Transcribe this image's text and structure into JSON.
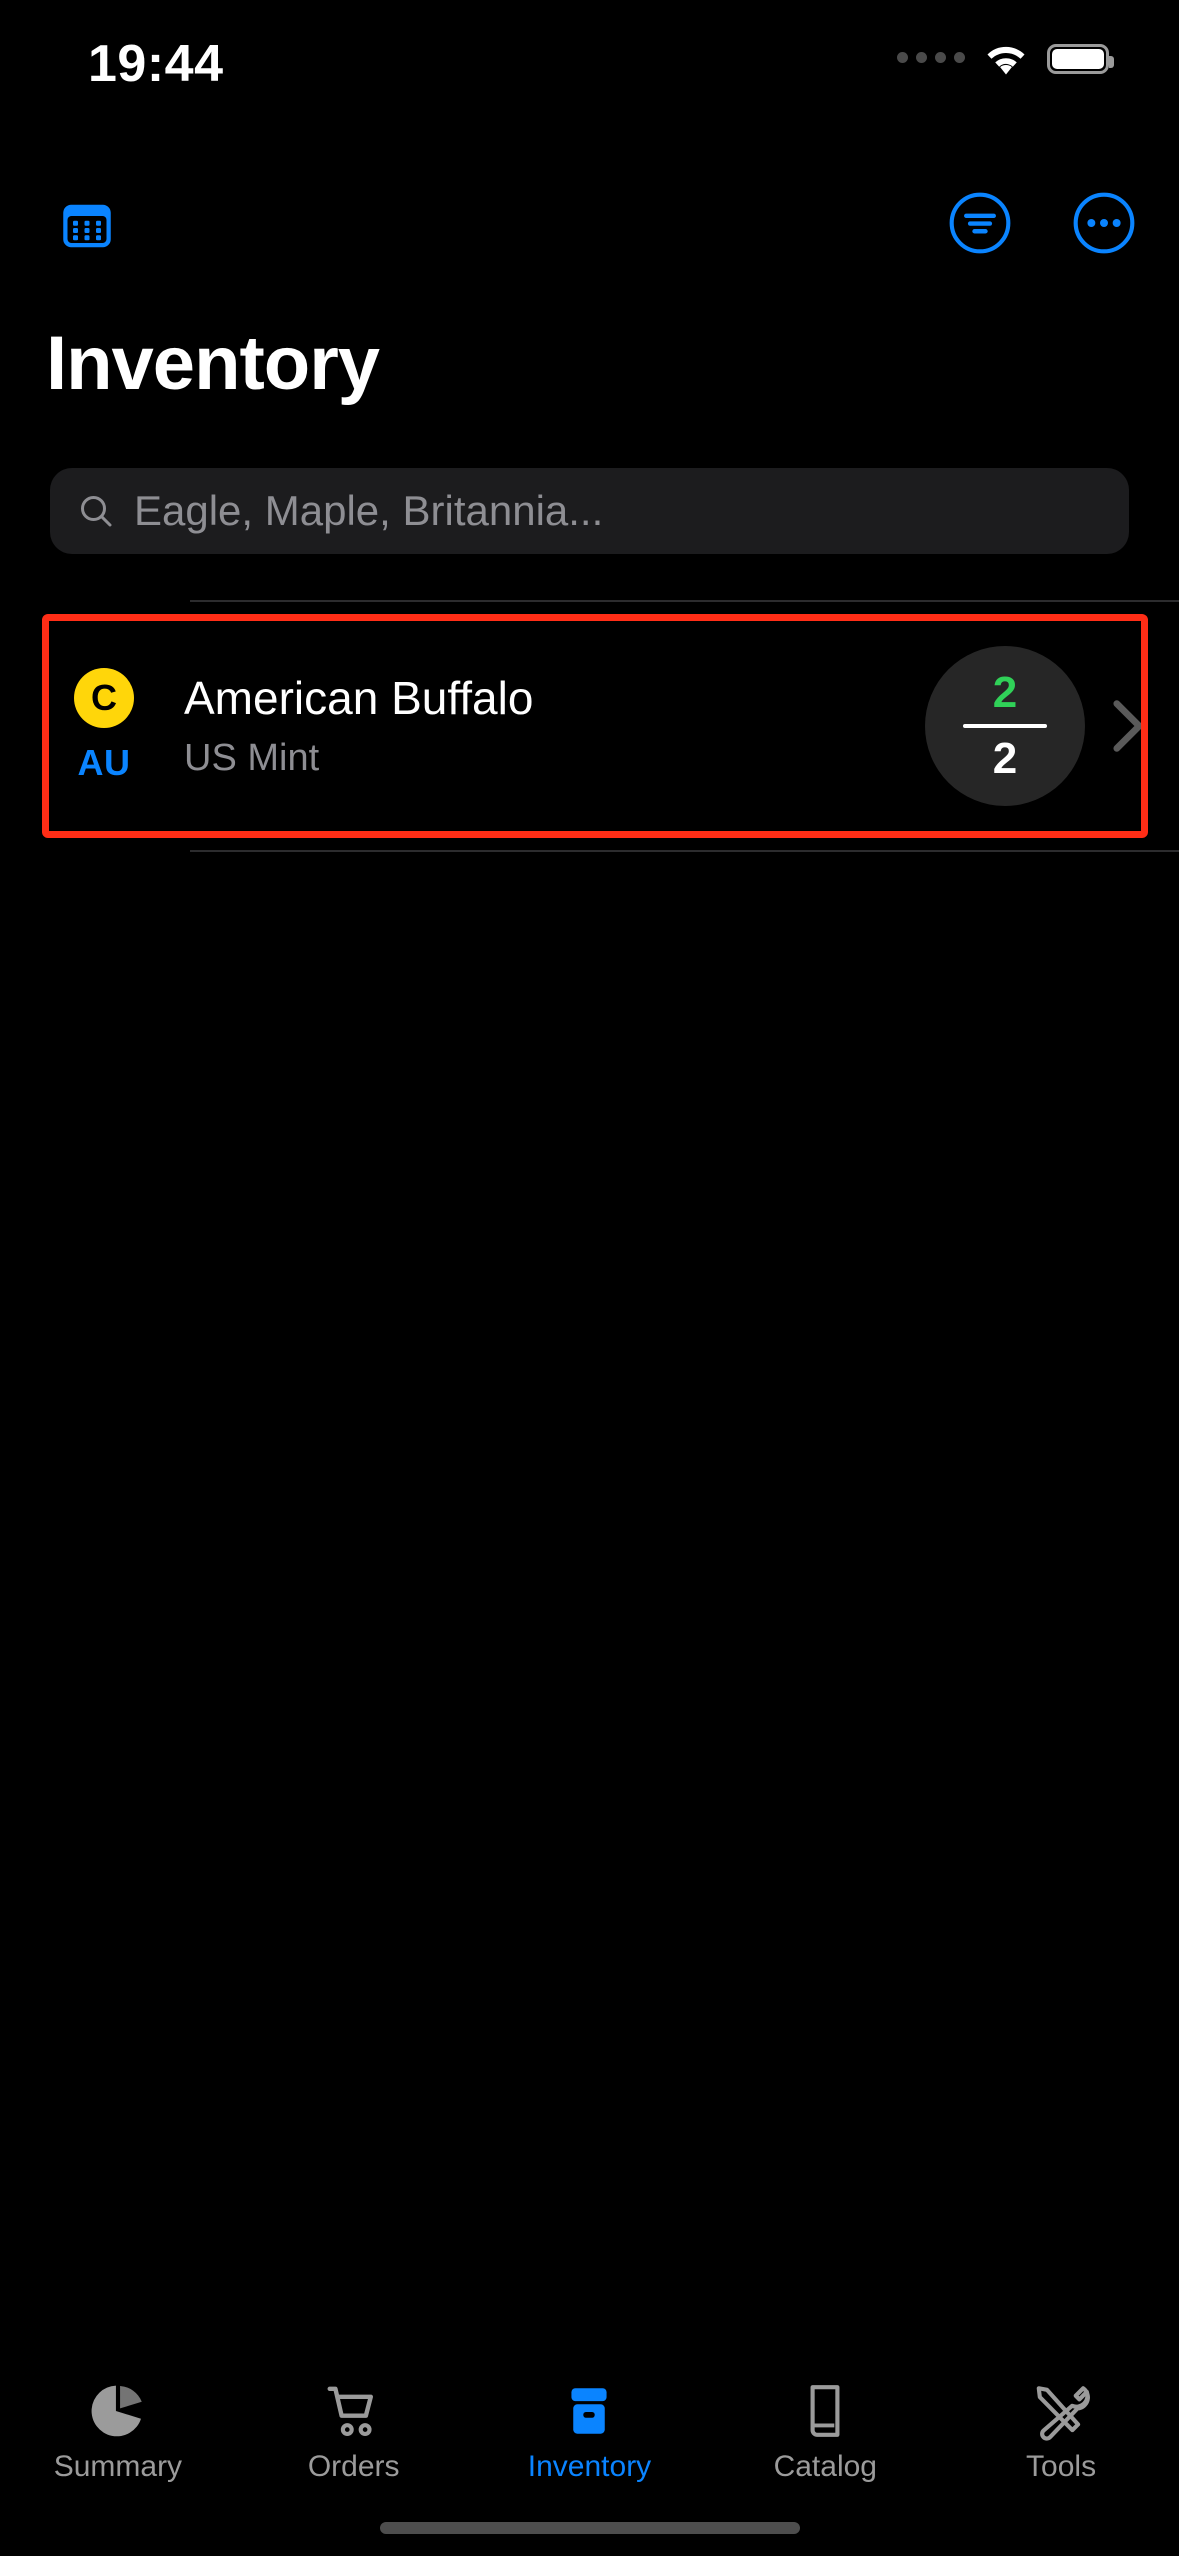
{
  "status_bar": {
    "time": "19:44",
    "signal_icon": "signal-dots-icon",
    "wifi_icon": "wifi-icon",
    "battery_icon": "battery-icon"
  },
  "nav_bar": {
    "left_button": {
      "name": "grid-view-button",
      "icon": "calendar-grid-icon"
    },
    "filter_button": {
      "name": "filter-button",
      "icon": "filter-lines-circle-icon"
    },
    "more_button": {
      "name": "more-options-button",
      "icon": "ellipsis-circle-icon"
    }
  },
  "header": {
    "title": "Inventory"
  },
  "search": {
    "icon": "search-icon",
    "placeholder": "Eagle, Maple, Britannia...",
    "value": ""
  },
  "colors": {
    "accent": "#0a84ff",
    "gold": "#ffd60a",
    "green": "#30d158",
    "highlight": "#ff2d16",
    "background": "#000000",
    "field": "#1c1c1e",
    "secondary_text": "#8e8e93"
  },
  "list": {
    "rows": [
      {
        "metal_letter": "C",
        "metal_symbol": "AU",
        "title": "American Buffalo",
        "subtitle": "US Mint",
        "qty_have": "2",
        "qty_total": "2",
        "chevron": "chevron-right-icon",
        "highlighted": true
      }
    ]
  },
  "tab_bar": {
    "items": [
      {
        "label": "Summary",
        "icon": "pie-chart-icon",
        "active": false
      },
      {
        "label": "Orders",
        "icon": "shopping-cart-icon",
        "active": false
      },
      {
        "label": "Inventory",
        "icon": "archive-box-icon",
        "active": true
      },
      {
        "label": "Catalog",
        "icon": "book-icon",
        "active": false
      },
      {
        "label": "Tools",
        "icon": "wrench-screwdriver-icon",
        "active": false
      }
    ]
  }
}
